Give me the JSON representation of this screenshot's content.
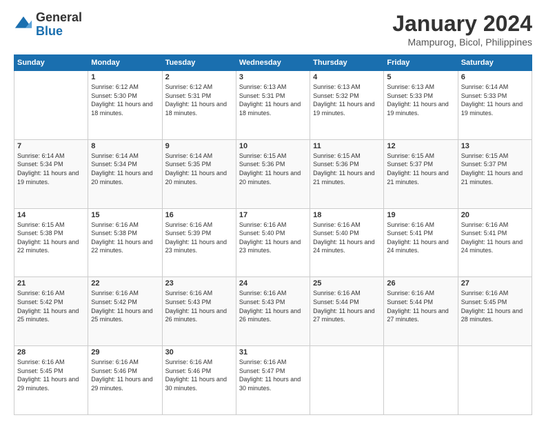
{
  "logo": {
    "line1": "General",
    "line2": "Blue"
  },
  "title": "January 2024",
  "subtitle": "Mampurog, Bicol, Philippines",
  "weekdays": [
    "Sunday",
    "Monday",
    "Tuesday",
    "Wednesday",
    "Thursday",
    "Friday",
    "Saturday"
  ],
  "weeks": [
    [
      {
        "num": "",
        "sunrise": "",
        "sunset": "",
        "daylight": ""
      },
      {
        "num": "1",
        "sunrise": "Sunrise: 6:12 AM",
        "sunset": "Sunset: 5:30 PM",
        "daylight": "Daylight: 11 hours and 18 minutes."
      },
      {
        "num": "2",
        "sunrise": "Sunrise: 6:12 AM",
        "sunset": "Sunset: 5:31 PM",
        "daylight": "Daylight: 11 hours and 18 minutes."
      },
      {
        "num": "3",
        "sunrise": "Sunrise: 6:13 AM",
        "sunset": "Sunset: 5:31 PM",
        "daylight": "Daylight: 11 hours and 18 minutes."
      },
      {
        "num": "4",
        "sunrise": "Sunrise: 6:13 AM",
        "sunset": "Sunset: 5:32 PM",
        "daylight": "Daylight: 11 hours and 19 minutes."
      },
      {
        "num": "5",
        "sunrise": "Sunrise: 6:13 AM",
        "sunset": "Sunset: 5:33 PM",
        "daylight": "Daylight: 11 hours and 19 minutes."
      },
      {
        "num": "6",
        "sunrise": "Sunrise: 6:14 AM",
        "sunset": "Sunset: 5:33 PM",
        "daylight": "Daylight: 11 hours and 19 minutes."
      }
    ],
    [
      {
        "num": "7",
        "sunrise": "Sunrise: 6:14 AM",
        "sunset": "Sunset: 5:34 PM",
        "daylight": "Daylight: 11 hours and 19 minutes."
      },
      {
        "num": "8",
        "sunrise": "Sunrise: 6:14 AM",
        "sunset": "Sunset: 5:34 PM",
        "daylight": "Daylight: 11 hours and 20 minutes."
      },
      {
        "num": "9",
        "sunrise": "Sunrise: 6:14 AM",
        "sunset": "Sunset: 5:35 PM",
        "daylight": "Daylight: 11 hours and 20 minutes."
      },
      {
        "num": "10",
        "sunrise": "Sunrise: 6:15 AM",
        "sunset": "Sunset: 5:36 PM",
        "daylight": "Daylight: 11 hours and 20 minutes."
      },
      {
        "num": "11",
        "sunrise": "Sunrise: 6:15 AM",
        "sunset": "Sunset: 5:36 PM",
        "daylight": "Daylight: 11 hours and 21 minutes."
      },
      {
        "num": "12",
        "sunrise": "Sunrise: 6:15 AM",
        "sunset": "Sunset: 5:37 PM",
        "daylight": "Daylight: 11 hours and 21 minutes."
      },
      {
        "num": "13",
        "sunrise": "Sunrise: 6:15 AM",
        "sunset": "Sunset: 5:37 PM",
        "daylight": "Daylight: 11 hours and 21 minutes."
      }
    ],
    [
      {
        "num": "14",
        "sunrise": "Sunrise: 6:15 AM",
        "sunset": "Sunset: 5:38 PM",
        "daylight": "Daylight: 11 hours and 22 minutes."
      },
      {
        "num": "15",
        "sunrise": "Sunrise: 6:16 AM",
        "sunset": "Sunset: 5:38 PM",
        "daylight": "Daylight: 11 hours and 22 minutes."
      },
      {
        "num": "16",
        "sunrise": "Sunrise: 6:16 AM",
        "sunset": "Sunset: 5:39 PM",
        "daylight": "Daylight: 11 hours and 23 minutes."
      },
      {
        "num": "17",
        "sunrise": "Sunrise: 6:16 AM",
        "sunset": "Sunset: 5:40 PM",
        "daylight": "Daylight: 11 hours and 23 minutes."
      },
      {
        "num": "18",
        "sunrise": "Sunrise: 6:16 AM",
        "sunset": "Sunset: 5:40 PM",
        "daylight": "Daylight: 11 hours and 24 minutes."
      },
      {
        "num": "19",
        "sunrise": "Sunrise: 6:16 AM",
        "sunset": "Sunset: 5:41 PM",
        "daylight": "Daylight: 11 hours and 24 minutes."
      },
      {
        "num": "20",
        "sunrise": "Sunrise: 6:16 AM",
        "sunset": "Sunset: 5:41 PM",
        "daylight": "Daylight: 11 hours and 24 minutes."
      }
    ],
    [
      {
        "num": "21",
        "sunrise": "Sunrise: 6:16 AM",
        "sunset": "Sunset: 5:42 PM",
        "daylight": "Daylight: 11 hours and 25 minutes."
      },
      {
        "num": "22",
        "sunrise": "Sunrise: 6:16 AM",
        "sunset": "Sunset: 5:42 PM",
        "daylight": "Daylight: 11 hours and 25 minutes."
      },
      {
        "num": "23",
        "sunrise": "Sunrise: 6:16 AM",
        "sunset": "Sunset: 5:43 PM",
        "daylight": "Daylight: 11 hours and 26 minutes."
      },
      {
        "num": "24",
        "sunrise": "Sunrise: 6:16 AM",
        "sunset": "Sunset: 5:43 PM",
        "daylight": "Daylight: 11 hours and 26 minutes."
      },
      {
        "num": "25",
        "sunrise": "Sunrise: 6:16 AM",
        "sunset": "Sunset: 5:44 PM",
        "daylight": "Daylight: 11 hours and 27 minutes."
      },
      {
        "num": "26",
        "sunrise": "Sunrise: 6:16 AM",
        "sunset": "Sunset: 5:44 PM",
        "daylight": "Daylight: 11 hours and 27 minutes."
      },
      {
        "num": "27",
        "sunrise": "Sunrise: 6:16 AM",
        "sunset": "Sunset: 5:45 PM",
        "daylight": "Daylight: 11 hours and 28 minutes."
      }
    ],
    [
      {
        "num": "28",
        "sunrise": "Sunrise: 6:16 AM",
        "sunset": "Sunset: 5:45 PM",
        "daylight": "Daylight: 11 hours and 29 minutes."
      },
      {
        "num": "29",
        "sunrise": "Sunrise: 6:16 AM",
        "sunset": "Sunset: 5:46 PM",
        "daylight": "Daylight: 11 hours and 29 minutes."
      },
      {
        "num": "30",
        "sunrise": "Sunrise: 6:16 AM",
        "sunset": "Sunset: 5:46 PM",
        "daylight": "Daylight: 11 hours and 30 minutes."
      },
      {
        "num": "31",
        "sunrise": "Sunrise: 6:16 AM",
        "sunset": "Sunset: 5:47 PM",
        "daylight": "Daylight: 11 hours and 30 minutes."
      },
      {
        "num": "",
        "sunrise": "",
        "sunset": "",
        "daylight": ""
      },
      {
        "num": "",
        "sunrise": "",
        "sunset": "",
        "daylight": ""
      },
      {
        "num": "",
        "sunrise": "",
        "sunset": "",
        "daylight": ""
      }
    ]
  ]
}
